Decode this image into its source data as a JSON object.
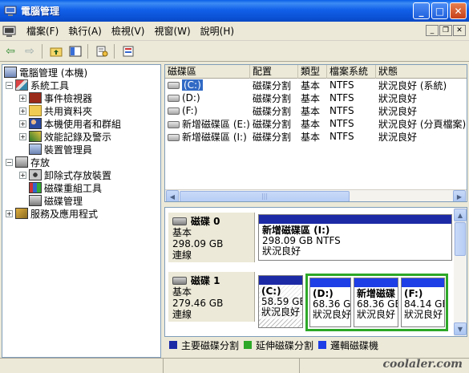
{
  "window": {
    "title": "電腦管理"
  },
  "menu": [
    "檔案(F)",
    "執行(A)",
    "檢視(V)",
    "視窗(W)",
    "說明(H)"
  ],
  "tree": {
    "root": "電腦管理 (本機)",
    "system_tools": "系統工具",
    "event_viewer": "事件檢視器",
    "shared_folders": "共用資料夾",
    "local_users": "本機使用者和群組",
    "perf_logs": "效能記錄及警示",
    "device_manager": "裝置管理員",
    "storage": "存放",
    "removable_storage": "卸除式存放裝置",
    "defrag": "磁碟重組工具",
    "disk_mgmt": "磁碟管理",
    "services": "服務及應用程式"
  },
  "volumes": {
    "headers": [
      "磁碟區",
      "配置",
      "類型",
      "檔案系統",
      "狀態"
    ],
    "rows": [
      {
        "name": "(C:)",
        "layout": "磁碟分割",
        "type": "基本",
        "fs": "NTFS",
        "status": "狀況良好 (系統)"
      },
      {
        "name": "(D:)",
        "layout": "磁碟分割",
        "type": "基本",
        "fs": "NTFS",
        "status": "狀況良好"
      },
      {
        "name": "(F:)",
        "layout": "磁碟分割",
        "type": "基本",
        "fs": "NTFS",
        "status": "狀況良好"
      },
      {
        "name": "新增磁碟區 (E:)",
        "layout": "磁碟分割",
        "type": "基本",
        "fs": "NTFS",
        "status": "狀況良好 (分頁檔案)"
      },
      {
        "name": "新增磁碟區 (I:)",
        "layout": "磁碟分割",
        "type": "基本",
        "fs": "NTFS",
        "status": "狀況良好"
      }
    ]
  },
  "disks": [
    {
      "name": "磁碟 0",
      "kind": "基本",
      "size": "298.09 GB",
      "state": "連線",
      "partitions": [
        {
          "name": "新增磁碟區 (I:)",
          "detail": "298.09 GB NTFS",
          "status": "狀況良好"
        }
      ]
    },
    {
      "name": "磁碟 1",
      "kind": "基本",
      "size": "279.46 GB",
      "state": "連線",
      "partitions": [
        {
          "name": "(C:)",
          "detail": "58.59 GE",
          "status": "狀況良好"
        },
        {
          "name": "(D:)",
          "detail": "68.36 G",
          "status": "狀況良好"
        },
        {
          "name": "新增磁碟",
          "detail": "68.36 GE",
          "status": "狀況良好"
        },
        {
          "name": "(F:)",
          "detail": "84.14 GE",
          "status": "狀況良好"
        }
      ]
    }
  ],
  "legend": [
    "主要磁碟分割",
    "延伸磁碟分割",
    "邏輯磁碟機"
  ],
  "colors": {
    "primary": "#1d2aa6",
    "extended": "#2da828",
    "logical": "#1e3ee6"
  },
  "watermark": "coolaler.com"
}
